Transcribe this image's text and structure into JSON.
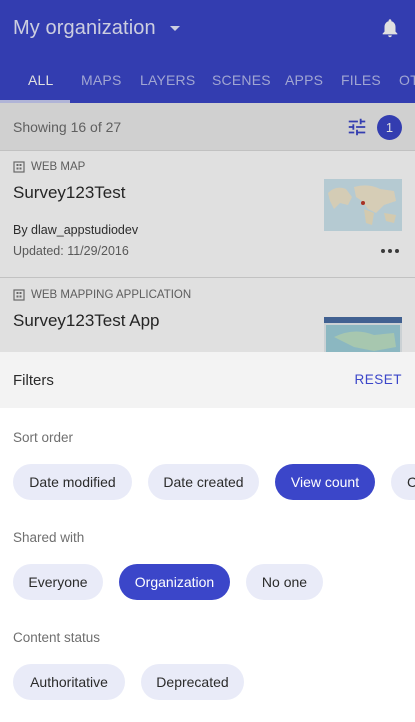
{
  "header": {
    "org_title": "My organization",
    "accent_color": "#3b46c9"
  },
  "tabs": [
    {
      "label": "ALL",
      "active": true
    },
    {
      "label": "MAPS"
    },
    {
      "label": "LAYERS"
    },
    {
      "label": "SCENES"
    },
    {
      "label": "APPS"
    },
    {
      "label": "FILES"
    },
    {
      "label": "OT"
    }
  ],
  "results": {
    "showing": "Showing 16 of 27",
    "filter_count": "1"
  },
  "items": [
    {
      "type": "WEB MAP",
      "title": "Survey123Test",
      "owner": "By dlaw_appstudiodev",
      "updated": "Updated: 11/29/2016"
    },
    {
      "type": "WEB MAPPING APPLICATION",
      "title": "Survey123Test App"
    }
  ],
  "filters": {
    "title": "Filters",
    "reset_label": "RESET",
    "sort_order": {
      "label": "Sort order",
      "options": [
        "Date modified",
        "Date created",
        "View count",
        "C"
      ],
      "selected": "View count"
    },
    "shared_with": {
      "label": "Shared with",
      "options": [
        "Everyone",
        "Organization",
        "No one"
      ],
      "selected": "Organization"
    },
    "content_status": {
      "label": "Content status",
      "options": [
        "Authoritative",
        "Deprecated"
      ]
    }
  }
}
